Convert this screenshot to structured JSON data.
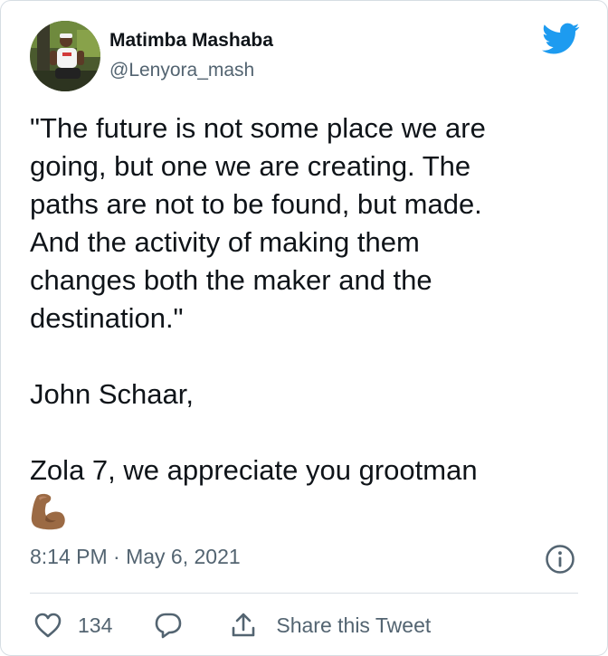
{
  "author": {
    "name": "Matimba Mashaba",
    "handle": "@Lenyora_mash"
  },
  "tweet": {
    "lines": [
      "\"The future is not some place we are",
      "going, but one we are creating. The",
      "paths are not to be found, but made.",
      "And the activity of making them",
      "changes both the maker and the",
      "destination.\""
    ],
    "attribution": "John Schaar,",
    "dedication": "Zola 7, we appreciate you grootman",
    "emoji": "flexed-biceps-medium-dark-skin-tone"
  },
  "meta": {
    "timestamp": "8:14 PM · May 6, 2021"
  },
  "actions": {
    "like_count": "134",
    "share_label": "Share this Tweet"
  },
  "icons": {
    "brand": "twitter-bird-icon",
    "info": "info-icon",
    "like": "heart-icon",
    "reply": "reply-bubble-icon",
    "share": "share-icon"
  },
  "colors": {
    "twitter_blue": "#1d9bf0",
    "text_primary": "#0f1419",
    "text_secondary": "#536471",
    "emoji_skin": "#9b6a44"
  }
}
